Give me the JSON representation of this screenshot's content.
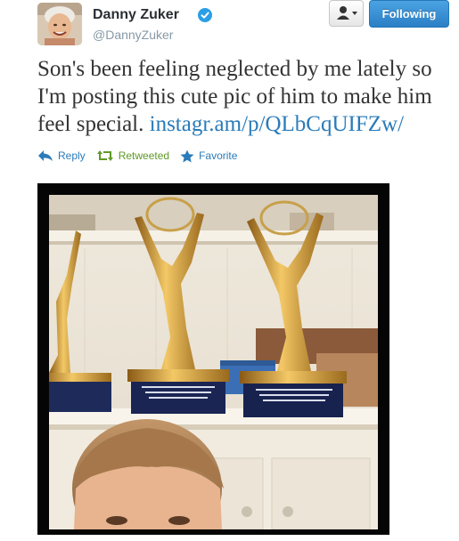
{
  "user": {
    "name": "Danny Zuker",
    "handle": "@DannyZuker",
    "avatar_icon": "user-photo-avatar",
    "verified_icon": "verified-badge-icon"
  },
  "buttons": {
    "user_actions_icon": "person-icon",
    "follow_label": "Following"
  },
  "tweet": {
    "text": "Son's been feeling neglected by me lately so I'm posting this cute pic of him to make him feel special. ",
    "link": "instagr.am/p/QLbCqUIFZw/"
  },
  "actions": {
    "reply": "Reply",
    "retweet": "Retweeted",
    "favorite": "Favorite"
  },
  "colors": {
    "link": "#2b7bb9",
    "retweeted": "#609928",
    "follow_button": "#3b8fd6"
  },
  "photo": {
    "alt": "instagram-photo"
  }
}
